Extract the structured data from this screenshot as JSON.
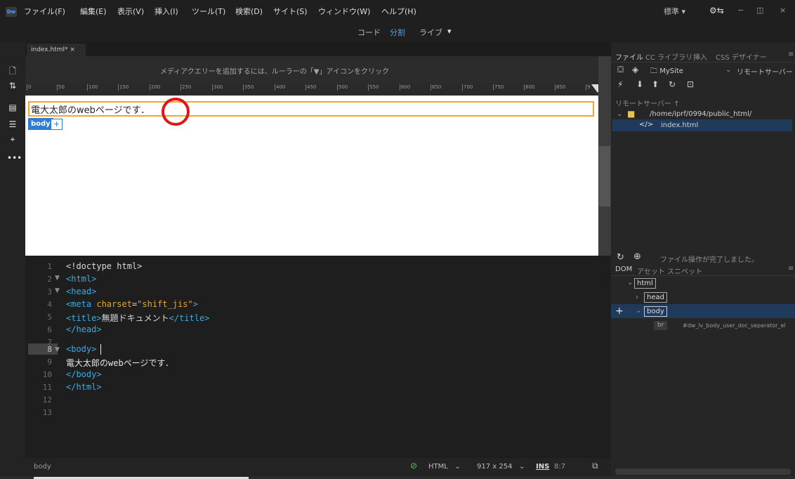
{
  "menu": {
    "logo": "Dw",
    "items": [
      "ファイル(F)",
      "編集(E)",
      "表示(V)",
      "挿入(I)",
      "ツール(T)",
      "検索(D)",
      "サイト(S)",
      "ウィンドウ(W)",
      "ヘルプ(H)"
    ],
    "workspace": "標準",
    "window_controls": [
      "−",
      "◫",
      "×"
    ]
  },
  "modes": [
    "コード",
    "分割",
    "ライブ"
  ],
  "document": {
    "tab_label": "index.html* ×",
    "media_query_hint": "メディアクエリーを追加するには、ルーラーの「▼」アイコンをクリック",
    "ruler_ticks": [
      "0",
      "50",
      "100",
      "150",
      "200",
      "250",
      "300",
      "350",
      "400",
      "450",
      "500",
      "550",
      "600",
      "650",
      "700",
      "750",
      "800",
      "850",
      "9"
    ],
    "live_text": "電大太郎のwebページです．",
    "body_tag": "body",
    "body_plus": "+"
  },
  "code": {
    "line_numbers": [
      "1",
      "2",
      "3",
      "4",
      "5",
      "6",
      "7",
      "8",
      "9",
      "10",
      "11",
      "12",
      "13"
    ],
    "fold_markers": [
      "▼",
      "▼",
      "▼"
    ],
    "lines": {
      "l1": "<!doctype html>",
      "l2": "<html>",
      "l3": "<head>",
      "l4_open": "<meta ",
      "l4_attr": "charset",
      "l4_eq": "=",
      "l4_val": "\"shift_jis\"",
      "l4_close": ">",
      "l5_open": "<title>",
      "l5_text": "無題ドキュメント",
      "l5_close": "</title>",
      "l6": "</head>",
      "l8": "<body>",
      "l9": "電大太郎のwebページです．",
      "l10": "</body>",
      "l11": "</html>"
    }
  },
  "status": {
    "element": "body",
    "language": "HTML",
    "size": "917 x 254",
    "insert_mode": "INS",
    "cursor": "8:7"
  },
  "files_panel": {
    "tabs": [
      "ファイル",
      "CC ライブラリ",
      "挿入",
      "CSS デザイナー"
    ],
    "site_name": "MySite",
    "server_dropdown": "リモートサーバー",
    "remote_server_label": "リモートサーバー ↑",
    "folder_path": "/home/iprf/0994/public_html/",
    "file_name": "index.html",
    "status_message": "ファイル操作が完了しました。"
  },
  "dom_panel": {
    "tabs": [
      "DOM",
      "アセット",
      "スニペット"
    ],
    "nodes": {
      "html": "html",
      "head": "head",
      "body": "body",
      "br": "br",
      "br_id": "#dw_lv_body_user_doc_separator_el"
    },
    "add_button": "+"
  }
}
